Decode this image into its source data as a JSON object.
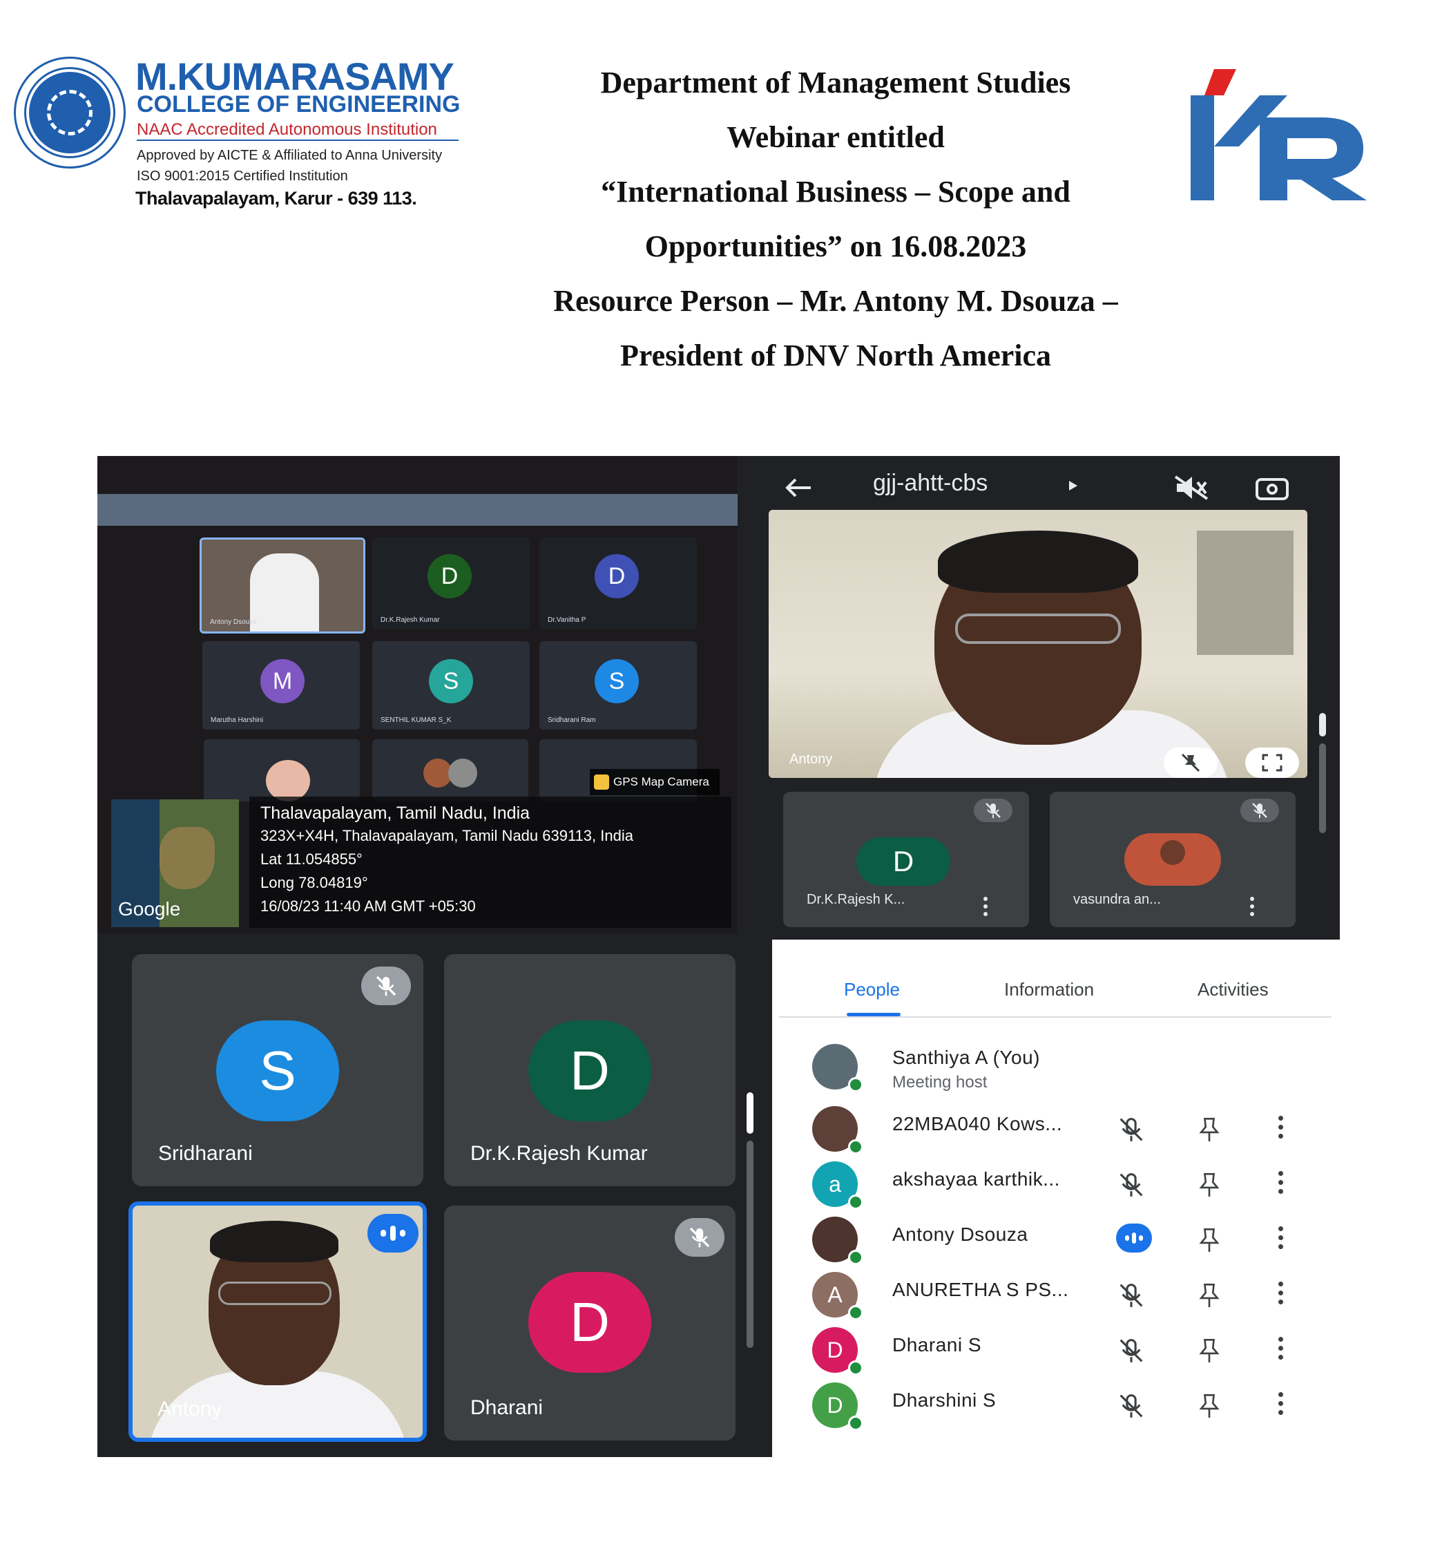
{
  "college": {
    "name": "M.KUMARASAMY",
    "subtitle": "COLLEGE OF ENGINEERING",
    "accreditation": "NAAC Accredited Autonomous Institution",
    "approval": "Approved by AICTE & Affiliated to Anna University",
    "iso": "ISO 9001:2015 Certified Institution",
    "address": "Thalavapalayam, Karur - 639 113."
  },
  "header": {
    "line1": "Department of Management Studies",
    "line2": "Webinar entitled",
    "line3": "“International Business – Scope and",
    "line4": "Opportunities” on 16.08.2023",
    "line5": "Resource Person – Mr. Antony M. Dsouza –",
    "line6": "President of DNV North America"
  },
  "laptop_photo": {
    "tiles": [
      {
        "label": "Antony Dsouza",
        "initial": ""
      },
      {
        "label": "Dr.K.Rajesh Kumar",
        "initial": "D",
        "color": "#1b5e20"
      },
      {
        "label": "Dr.Vanitha P",
        "initial": "D",
        "color": "#3f51b5"
      },
      {
        "label": "Marutha Harshini",
        "initial": "M",
        "color": "#7e57c2"
      },
      {
        "label": "SENTHIL KUMAR S_K",
        "initial": "S",
        "color": "#26a69a"
      },
      {
        "label": "Sridharani Ram",
        "initial": "S",
        "color": "#1e88e5"
      }
    ],
    "gps_camera_label": "GPS Map Camera",
    "map_label": "Google",
    "location_title": "Thalavapalayam, Tamil Nadu, India",
    "location_address": "323X+X4H, Thalavapalayam, Tamil Nadu 639113, India",
    "lat": "Lat 11.054855°",
    "long": "Long 78.04819°",
    "timestamp": "16/08/23 11:40 AM GMT +05:30"
  },
  "phone_top": {
    "meeting_code": "gjj-ahtt-cbs",
    "main_video_name": "Antony",
    "tiles": [
      {
        "name": "Dr.K.Rajesh K...",
        "initial": "D",
        "color": "#0b5d43"
      },
      {
        "name": "vasundra an...",
        "initial": "",
        "color": "#c0543a"
      }
    ]
  },
  "meet_grid": {
    "tiles": [
      {
        "name": "Sridharani",
        "initial": "S",
        "color": "#1b8ce0"
      },
      {
        "name": "Dr.K.Rajesh Kumar",
        "initial": "D",
        "color": "#0b5d43"
      },
      {
        "name": "Antony",
        "initial": ""
      },
      {
        "name": "Dharani",
        "initial": "D",
        "color": "#d81b60"
      }
    ]
  },
  "people_panel": {
    "tabs": [
      "People",
      "Information",
      "Activities"
    ],
    "active_tab": "People",
    "host": {
      "name": "Santhiya A (You)",
      "role": "Meeting host"
    },
    "participants": [
      {
        "name": "22MBA040 Kows...",
        "initial": "",
        "color": "#5d4037",
        "speaking": false
      },
      {
        "name": "akshayaa karthik...",
        "initial": "a",
        "color": "#12a4b2",
        "speaking": false
      },
      {
        "name": "Antony Dsouza",
        "initial": "",
        "color": "#4e342e",
        "speaking": true
      },
      {
        "name": "ANURETHA S PS...",
        "initial": "A",
        "color": "#8d6e63",
        "speaking": false
      },
      {
        "name": "Dharani S",
        "initial": "D",
        "color": "#d81b60",
        "speaking": false
      },
      {
        "name": "Dharshini S",
        "initial": "D",
        "color": "#43a047",
        "speaking": false
      }
    ]
  }
}
